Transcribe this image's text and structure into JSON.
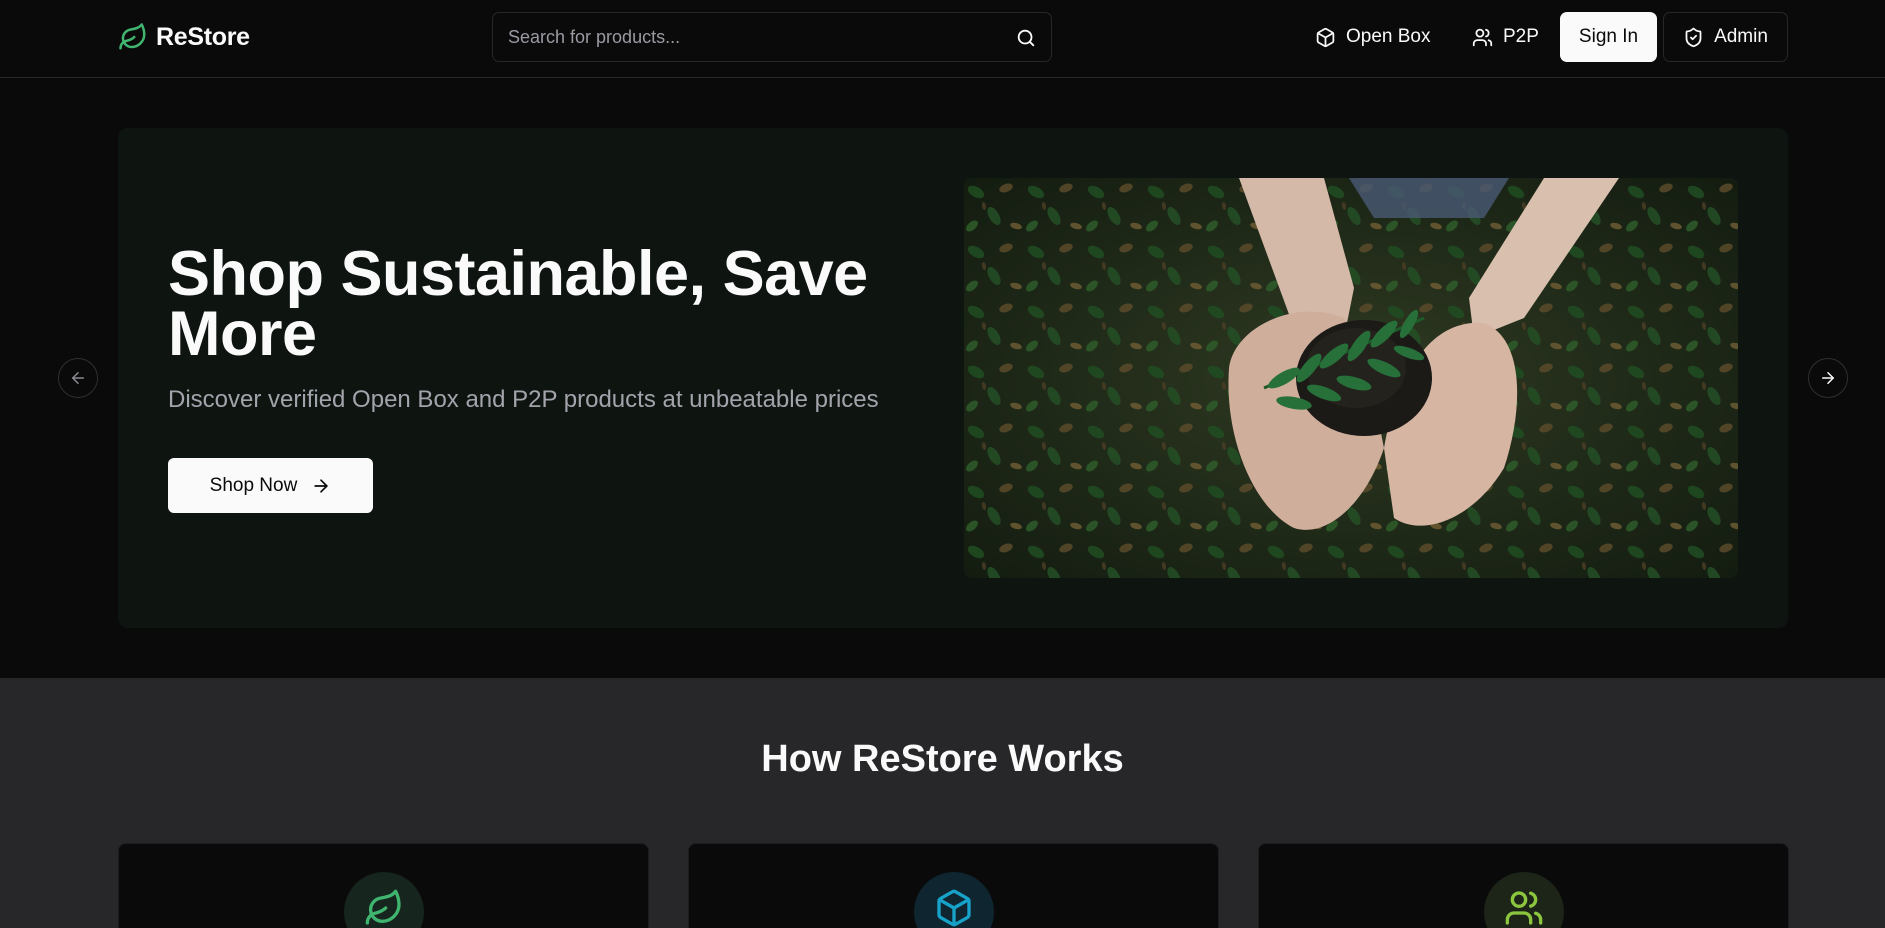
{
  "header": {
    "brand": "ReStore",
    "search_placeholder": "Search for products...",
    "nav": {
      "open_box": "Open Box",
      "p2p": "P2P",
      "sign_in": "Sign In",
      "admin": "Admin"
    }
  },
  "hero": {
    "title": "Shop Sustainable, Save More",
    "subtitle": "Discover verified Open Box and P2P products at unbeatable prices",
    "cta": "Shop Now"
  },
  "how": {
    "title": "How ReStore Works"
  },
  "icons": {
    "logo": "leaf-icon",
    "search": "search-icon",
    "open_box": "box-icon",
    "p2p": "users-icon",
    "admin": "shield-check-icon",
    "cta": "arrow-right-icon",
    "prev": "arrow-left-icon",
    "next": "arrow-right-icon",
    "card_1": "leaf-icon",
    "card_2": "box-icon",
    "card_3": "users-icon"
  },
  "colors": {
    "brand_green": "#3fb56f",
    "box_blue": "#17a2c9",
    "users_lime": "#8cc63f",
    "background": "#0a0a0b",
    "section_bg": "#27272a"
  }
}
